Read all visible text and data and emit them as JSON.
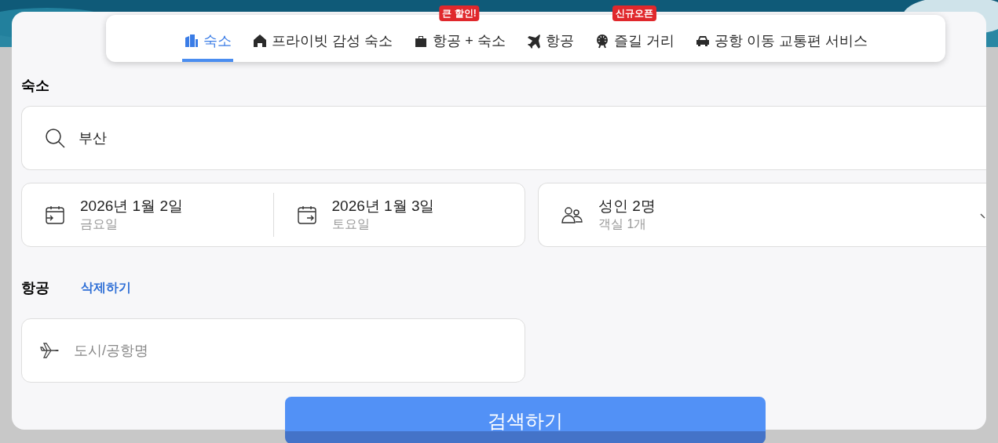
{
  "tabs": [
    {
      "label": "숙소",
      "kind": "building",
      "selected": true
    },
    {
      "label": "프라이빗 감성 숙소",
      "kind": "house",
      "selected": false
    },
    {
      "label": "항공 + 숙소",
      "kind": "luggage",
      "selected": false,
      "badge": "큰 할인!"
    },
    {
      "label": "항공",
      "kind": "plane",
      "selected": false
    },
    {
      "label": "즐길 거리",
      "kind": "wheel",
      "selected": false,
      "badge": "신규오픈"
    },
    {
      "label": "공항 이동 교통편 서비스",
      "kind": "car",
      "selected": false
    }
  ],
  "stay": {
    "heading": "숙소",
    "search_value": "부산",
    "check_in": {
      "date": "2026년 1월 2일",
      "weekday": "금요일"
    },
    "check_out": {
      "date": "2026년 1월 3일",
      "weekday": "토요일"
    },
    "guests": {
      "main": "성인 2명",
      "sub": "객실 1개"
    }
  },
  "flight": {
    "heading": "항공",
    "remove_link": "삭제하기",
    "placeholder": "도시/공항명"
  },
  "search_button": "검색하기"
}
